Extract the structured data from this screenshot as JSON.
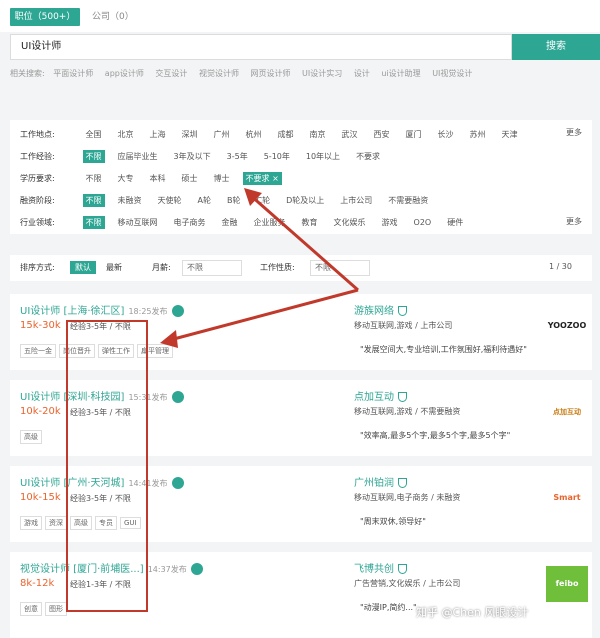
{
  "tabs": {
    "positions": "职位（500+）",
    "companies": "公司（0）"
  },
  "search": {
    "value": "UI设计师",
    "button": "搜索"
  },
  "related": {
    "label": "相关搜索:",
    "items": [
      "平面设计师",
      "app设计师",
      "交互设计",
      "视觉设计师",
      "网页设计师",
      "UI设计实习",
      "设计",
      "ui设计助理",
      "UI视觉设计"
    ]
  },
  "filters": {
    "location": {
      "label": "工作地点:",
      "options": [
        "全国",
        "北京",
        "上海",
        "深圳",
        "广州",
        "杭州",
        "成都",
        "南京",
        "武汉",
        "西安",
        "厦门",
        "长沙",
        "苏州",
        "天津"
      ],
      "more": "更多"
    },
    "experience": {
      "label": "工作经验:",
      "options": [
        "不限",
        "应届毕业生",
        "3年及以下",
        "3-5年",
        "5-10年",
        "10年以上",
        "不要求"
      ]
    },
    "education": {
      "label": "学历要求:",
      "options": [
        "不限",
        "大专",
        "本科",
        "硕士",
        "博士",
        "不要求 ×"
      ]
    },
    "funding": {
      "label": "融资阶段:",
      "options": [
        "不限",
        "未融资",
        "天使轮",
        "A轮",
        "B轮",
        "C轮",
        "D轮及以上",
        "上市公司",
        "不需要融资"
      ]
    },
    "industry": {
      "label": "行业领域:",
      "options": [
        "不限",
        "移动互联网",
        "电子商务",
        "金融",
        "企业服务",
        "教育",
        "文化娱乐",
        "游戏",
        "O2O",
        "硬件"
      ],
      "more": "更多"
    }
  },
  "sort": {
    "label": "排序方式:",
    "default": "默认",
    "latest": "最新",
    "salary_label": "月薪:",
    "salary_value": "不限",
    "type_label": "工作性质:",
    "type_value": "不限",
    "pager": "1 / 30"
  },
  "jobs": [
    {
      "title": "UI设计师 [上海·徐汇区]",
      "time": "18:25发布",
      "salary": "15k-30k",
      "exp": "经验3-5年 / 不限",
      "tags": [
        "五险一金",
        "岗位晋升",
        "弹性工作",
        "扁平管理"
      ],
      "company": "游族网络",
      "info": "移动互联网,游戏 / 上市公司",
      "quote": "\"发展空间大,专业培训,工作氛围好,福利待遇好\"",
      "logo": "YOOZOO"
    },
    {
      "title": "UI设计师 [深圳·科技园]",
      "time": "15:31发布",
      "salary": "10k-20k",
      "exp": "经验3-5年 / 不限",
      "tags": [
        "高级"
      ],
      "company": "点加互动",
      "info": "移动互联网,游戏 / 不需要融资",
      "quote": "\"效率高,最多5个字,最多5个字,最多5个字\"",
      "logo": "点加互动"
    },
    {
      "title": "UI设计师 [广州·天河城]",
      "time": "14:41发布",
      "salary": "10k-15k",
      "exp": "经验3-5年 / 不限",
      "tags": [
        "游戏",
        "资深",
        "高级",
        "专员",
        "GUI"
      ],
      "company": "广州铂润",
      "info": "移动互联网,电子商务 / 未融资",
      "quote": "\"周末双休,领导好\"",
      "logo": "Smart"
    },
    {
      "title": "视觉设计师 [厦门·前埔医...]",
      "time": "14:37发布",
      "salary": "8k-12k",
      "exp": "经验1-3年 / 不限",
      "tags": [
        "创意",
        "图形"
      ],
      "company": "飞博共创",
      "info": "广告营销,文化娱乐 / 上市公司",
      "quote": "\"动漫IP,简约...\"",
      "logo": "feibo"
    }
  ],
  "watermark": "知乎 @Chen 风眼设计"
}
